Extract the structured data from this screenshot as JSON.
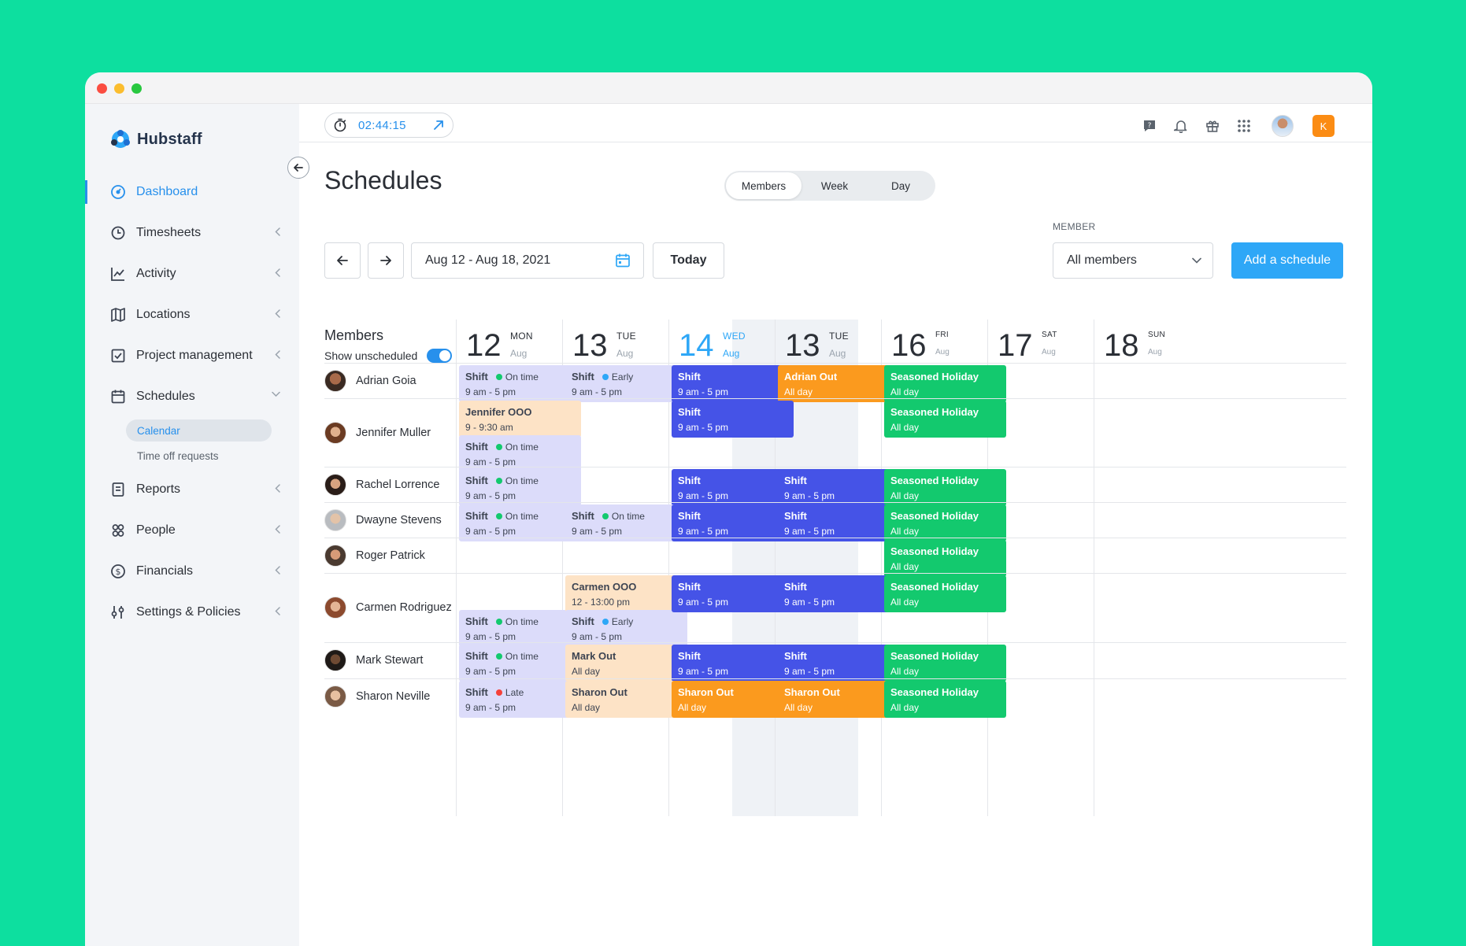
{
  "app": {
    "name": "Hubstaff",
    "timer": "02:44:15"
  },
  "sidebar": {
    "items": [
      {
        "key": "dashboard",
        "label": "Dashboard",
        "active": true,
        "chevron": false
      },
      {
        "key": "timesheets",
        "label": "Timesheets",
        "chevron": true
      },
      {
        "key": "activity",
        "label": "Activity",
        "chevron": true
      },
      {
        "key": "locations",
        "label": "Locations",
        "chevron": true
      },
      {
        "key": "project-management",
        "label": "Project management",
        "chevron": true
      },
      {
        "key": "schedules",
        "label": "Schedules",
        "chevron": true,
        "expanded": true
      },
      {
        "key": "reports",
        "label": "Reports",
        "chevron": true
      },
      {
        "key": "people",
        "label": "People",
        "chevron": true
      },
      {
        "key": "financials",
        "label": "Financials",
        "chevron": true
      },
      {
        "key": "settings-policies",
        "label": "Settings & Policies",
        "chevron": true
      }
    ],
    "schedules_sub": [
      {
        "label": "Calendar",
        "active": true
      },
      {
        "label": "Time off requests"
      }
    ]
  },
  "topbar": {
    "user_initial": "K"
  },
  "page": {
    "title": "Schedules",
    "views": [
      "Members",
      "Week",
      "Day"
    ],
    "active_view": "Members",
    "date_range": "Aug 12 - Aug 18, 2021",
    "today_label": "Today",
    "member_label": "MEMBER",
    "member_value": "All members",
    "add_label": "Add a schedule"
  },
  "calendar": {
    "members_title": "Members",
    "show_unscheduled": "Show unscheduled",
    "days": [
      {
        "num": "12",
        "dow": "MON",
        "mon": "Aug"
      },
      {
        "num": "13",
        "dow": "TUE",
        "mon": "Aug"
      },
      {
        "num": "14",
        "dow": "WED",
        "mon": "Aug",
        "today": true
      },
      {
        "num": "13",
        "dow": "TUE",
        "mon": "Aug"
      },
      {
        "num": "16",
        "dow": "FRI",
        "mon": "Aug",
        "small": true
      },
      {
        "num": "17",
        "dow": "SAT",
        "mon": "Aug",
        "small": true
      },
      {
        "num": "18",
        "dow": "SUN",
        "mon": "Aug",
        "small": true
      }
    ],
    "rows": [
      {
        "name": "Adrian Goia",
        "events": [
          {
            "day": 0,
            "slot": 0,
            "style": "lav",
            "title": "Shift",
            "status": "On time",
            "sub": "9 am - 5 pm"
          },
          {
            "day": 1,
            "slot": 0,
            "style": "lav",
            "title": "Shift",
            "status": "Early",
            "sub": "9 am - 5 pm"
          },
          {
            "day": 2,
            "slot": 0,
            "style": "blue",
            "title": "Shift",
            "sub": "9 am - 5 pm"
          },
          {
            "day": 3,
            "slot": 0,
            "style": "orange",
            "title": "Adrian Out",
            "sub": "All day"
          },
          {
            "day": 4,
            "slot": 0,
            "style": "green",
            "title": "Seasoned Holiday",
            "sub": "All day"
          }
        ]
      },
      {
        "name": "Jennifer Muller",
        "events": [
          {
            "day": 0,
            "slot": 0,
            "style": "peach",
            "title": "Jennifer OOO",
            "sub": "9 - 9:30 am"
          },
          {
            "day": 0,
            "slot": 1,
            "style": "lav",
            "title": "Shift",
            "status": "On time",
            "sub": "9 am - 5 pm"
          },
          {
            "day": 2,
            "slot": 0,
            "style": "blue",
            "title": "Shift",
            "sub": "9 am - 5 pm"
          },
          {
            "day": 4,
            "slot": 0,
            "style": "green",
            "title": "Seasoned Holiday",
            "sub": "All day"
          }
        ]
      },
      {
        "name": "Rachel Lorrence",
        "events": [
          {
            "day": 0,
            "slot": 0,
            "style": "lav",
            "title": "Shift",
            "status": "On time",
            "sub": "9 am - 5 pm"
          },
          {
            "day": 2,
            "slot": 0,
            "style": "blue",
            "title": "Shift",
            "sub": "9 am - 5 pm"
          },
          {
            "day": 3,
            "slot": 0,
            "style": "blue",
            "title": "Shift",
            "sub": "9 am - 5 pm"
          },
          {
            "day": 4,
            "slot": 0,
            "style": "green",
            "title": "Seasoned Holiday",
            "sub": "All day"
          }
        ]
      },
      {
        "name": "Dwayne Stevens",
        "events": [
          {
            "day": 0,
            "slot": 0,
            "style": "lav",
            "title": "Shift",
            "status": "On time",
            "sub": "9 am - 5 pm"
          },
          {
            "day": 1,
            "slot": 0,
            "style": "lav",
            "title": "Shift",
            "status": "On time",
            "sub": "9 am - 5 pm"
          },
          {
            "day": 2,
            "slot": 0,
            "style": "blue",
            "title": "Shift",
            "sub": "9 am - 5 pm"
          },
          {
            "day": 3,
            "slot": 0,
            "style": "blue",
            "title": "Shift",
            "sub": "9 am - 5 pm"
          },
          {
            "day": 4,
            "slot": 0,
            "style": "green",
            "title": "Seasoned Holiday",
            "sub": "All day"
          }
        ]
      },
      {
        "name": "Roger Patrick",
        "events": [
          {
            "day": 4,
            "slot": 0,
            "style": "green",
            "title": "Seasoned Holiday",
            "sub": "All day"
          }
        ]
      },
      {
        "name": "Carmen Rodriguez",
        "events": [
          {
            "day": 0,
            "slot": 1,
            "style": "lav",
            "title": "Shift",
            "status": "On time",
            "sub": "9 am - 5 pm"
          },
          {
            "day": 1,
            "slot": 0,
            "style": "peach",
            "title": "Carmen OOO",
            "sub": "12 - 13:00 pm"
          },
          {
            "day": 1,
            "slot": 1,
            "style": "lav",
            "title": "Shift",
            "status": "Early",
            "sub": "9 am - 5 pm"
          },
          {
            "day": 2,
            "slot": 0,
            "style": "blue",
            "title": "Shift",
            "sub": "9 am - 5 pm"
          },
          {
            "day": 3,
            "slot": 0,
            "style": "blue",
            "title": "Shift",
            "sub": "9 am - 5 pm"
          },
          {
            "day": 4,
            "slot": 0,
            "style": "green",
            "title": "Seasoned Holiday",
            "sub": "All day"
          }
        ]
      },
      {
        "name": "Mark Stewart",
        "events": [
          {
            "day": 0,
            "slot": 0,
            "style": "lav",
            "title": "Shift",
            "status": "On time",
            "sub": "9 am - 5 pm"
          },
          {
            "day": 1,
            "slot": 0,
            "style": "peach",
            "title": "Mark Out",
            "sub": "All day"
          },
          {
            "day": 2,
            "slot": 0,
            "style": "blue",
            "title": "Shift",
            "sub": "9 am - 5 pm"
          },
          {
            "day": 3,
            "slot": 0,
            "style": "blue",
            "title": "Shift",
            "sub": "9 am - 5 pm"
          },
          {
            "day": 4,
            "slot": 0,
            "style": "green",
            "title": "Seasoned Holiday",
            "sub": "All day"
          }
        ]
      },
      {
        "name": "Sharon Neville",
        "events": [
          {
            "day": 0,
            "slot": 0,
            "style": "lav",
            "title": "Shift",
            "status": "Late",
            "sub": "9 am - 5 pm"
          },
          {
            "day": 1,
            "slot": 0,
            "style": "peach",
            "title": "Sharon Out",
            "sub": "All day"
          },
          {
            "day": 2,
            "slot": 0,
            "style": "orange",
            "title": "Sharon Out",
            "sub": "All day"
          },
          {
            "day": 3,
            "slot": 0,
            "style": "orange",
            "title": "Sharon Out",
            "sub": "All day"
          },
          {
            "day": 4,
            "slot": 0,
            "style": "green",
            "title": "Seasoned Holiday",
            "sub": "All day"
          }
        ]
      }
    ]
  },
  "colors": {
    "accent": "#2790ec",
    "on_time": "#13c96e",
    "early": "#2ea7f7",
    "late": "#f5413b"
  }
}
